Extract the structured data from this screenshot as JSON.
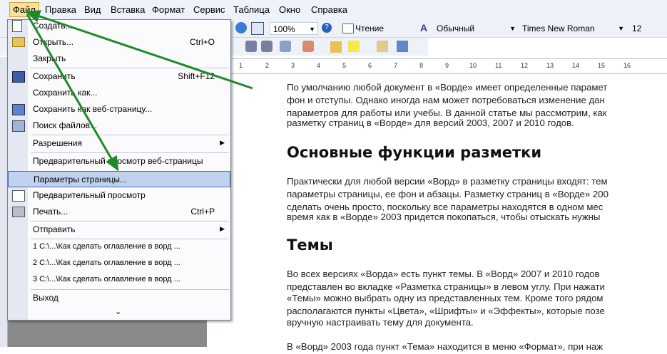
{
  "menubar": {
    "items": [
      "Файл",
      "Правка",
      "Вид",
      "Вставка",
      "Формат",
      "Сервис",
      "Таблица",
      "Окно",
      "Справка"
    ]
  },
  "toolbar": {
    "zoom": "100%",
    "reading": "Чтение",
    "style": "Обычный",
    "font": "Times New Roman",
    "size": "12"
  },
  "ruler": [
    "1",
    "2",
    "3",
    "4",
    "5",
    "6",
    "7",
    "8",
    "9",
    "10",
    "11",
    "12",
    "13",
    "14",
    "15",
    "16"
  ],
  "menu": {
    "items": [
      {
        "label": "Создать...",
        "shortcut": ""
      },
      {
        "label": "Открыть...",
        "shortcut": "Ctrl+O"
      },
      {
        "label": "Закрыть",
        "shortcut": ""
      },
      {
        "label": "Сохранить",
        "shortcut": "Shift+F12"
      },
      {
        "label": "Сохранить как...",
        "shortcut": ""
      },
      {
        "label": "Сохранить как веб-страницу...",
        "shortcut": ""
      },
      {
        "label": "Поиск файлов...",
        "shortcut": ""
      },
      {
        "label": "Разрешения",
        "shortcut": ""
      },
      {
        "label": "Предварительный просмотр веб-страницы",
        "shortcut": ""
      },
      {
        "label": "Параметры страницы...",
        "shortcut": ""
      },
      {
        "label": "Предварительный просмотр",
        "shortcut": ""
      },
      {
        "label": "Печать...",
        "shortcut": "Ctrl+P"
      },
      {
        "label": "Отправить",
        "shortcut": ""
      },
      {
        "label": "1 C:\\...\\Как сделать оглавление в ворд ...",
        "shortcut": ""
      },
      {
        "label": "2 C:\\...\\Как сделать оглавление в ворд ...",
        "shortcut": ""
      },
      {
        "label": "3 C:\\...\\Как сделать оглавление в ворд ...",
        "shortcut": ""
      },
      {
        "label": "Выход",
        "shortcut": ""
      }
    ],
    "more": "⌄"
  },
  "document": {
    "p1": [
      "По умолчанию любой документ в «Ворде» имеет определенные парамет",
      "фон и отступы. Однако иногда нам может потребоваться изменение дан",
      "параметров для работы или учебы. В данной статье мы рассмотрим, как",
      "разметку страниц в «Ворде» для версий 2003, 2007 и 2010 годов."
    ],
    "h1": "Основные функции разметки",
    "p2": [
      "Практически для любой версии «Ворд» в разметку страницы входят: тем",
      "параметры страницы, ее фон и абзацы. Разметку страниц в «Ворде» 200",
      "сделать очень просто, поскольку все параметры находятся в одном мес",
      "время как в «Ворде» 2003 придется покопаться, чтобы отыскать нужны"
    ],
    "h2": "Темы",
    "p3": [
      "Во всех версиях «Ворда» есть пункт темы. В «Ворд» 2007 и 2010 годов",
      "представлен во вкладке «Разметка страницы» в левом углу. При нажати",
      "«Темы» можно выбрать одну из представленных тем. Кроме того рядом",
      "располагаются пункты «Цвета», «Шрифты» и «Эффекты», которые позе",
      "вручную настраивать тему для документа."
    ],
    "p4": "В «Ворд» 2003 года пункт «Тема» находится в меню «Формат», при наж"
  },
  "colors": {
    "arrow": "#1f8a2a",
    "highlight": "#c1d2ee",
    "menubar": "#eef2fb"
  }
}
